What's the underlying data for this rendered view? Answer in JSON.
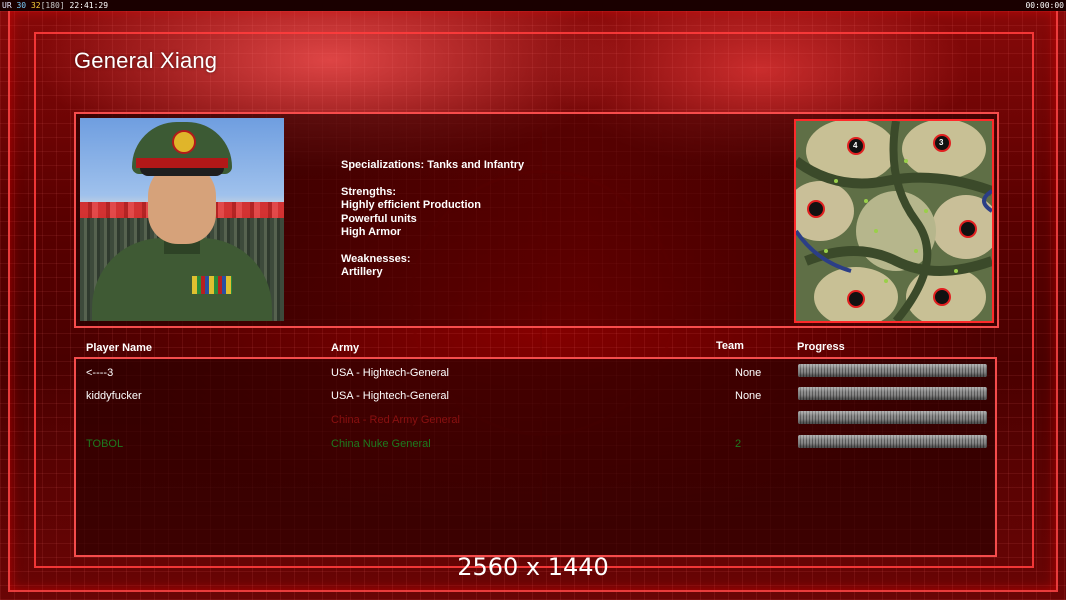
{
  "status_bar": {
    "ur_label": "UR",
    "fps_a": "30",
    "fps_b": "32",
    "bracket_value": "[180]",
    "clock": "22:41:29",
    "game_timer": "00:00:00"
  },
  "general_title": "General Xiang",
  "description": {
    "specializations": "Specializations: Tanks and Infantry",
    "strengths_heading": "Strengths:",
    "strengths": [
      "Highly efficient Production",
      "Powerful units",
      "High Armor"
    ],
    "weaknesses_heading": "Weaknesses:",
    "weaknesses": [
      "Artillery"
    ]
  },
  "minimap": {
    "start_markers": [
      "4",
      "3"
    ]
  },
  "table": {
    "headers": {
      "player_name": "Player Name",
      "army": "Army",
      "team": "Team",
      "progress": "Progress"
    },
    "rows": [
      {
        "name": "<----3",
        "army": "USA - Hightech-General",
        "team": "None",
        "color": "#ffffff",
        "progress": 0
      },
      {
        "name": "kiddyfucker",
        "army": "USA - Hightech-General",
        "team": "None",
        "color": "#ffffff",
        "progress": 0
      },
      {
        "name": "",
        "army": "China - Red Army General",
        "team": "",
        "color": "#8a1010",
        "progress": 0
      },
      {
        "name": "TOBOL",
        "army": "China Nuke General",
        "team": "2",
        "color": "#1e7a1e",
        "progress": 0
      }
    ]
  },
  "resolution_text": "2560 x 1440",
  "colors": {
    "frame": "#ff4040",
    "background": "#5a0000"
  }
}
